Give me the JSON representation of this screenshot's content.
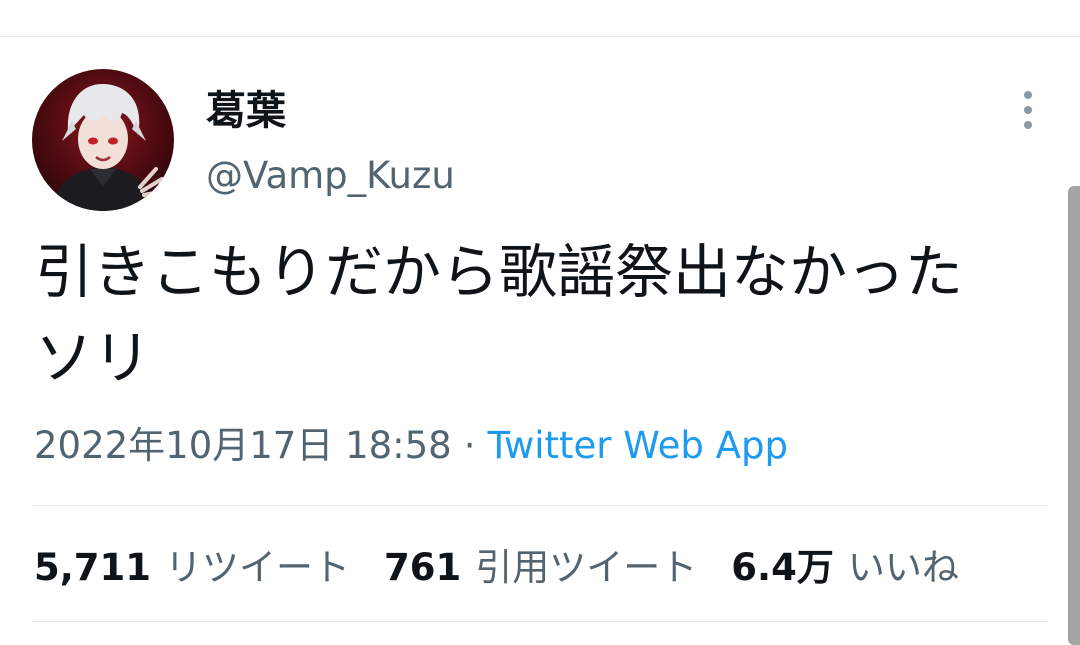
{
  "tweet": {
    "author": {
      "display_name": "葛葉",
      "handle": "@Vamp_Kuzu"
    },
    "text": "引きこもりだから歌謡祭出なかった\nソリ",
    "timestamp": "2022年10月17日 18:58",
    "separator": "·",
    "source": "Twitter Web App"
  },
  "stats": [
    {
      "count": "5,711",
      "label": "リツイート"
    },
    {
      "count": "761",
      "label": "引用ツイート"
    },
    {
      "count": "6.4万",
      "label": "いいね"
    }
  ],
  "icons": {
    "more": "more-vertical-icon"
  },
  "colors": {
    "text_primary": "#0f1419",
    "text_secondary": "#536471",
    "link": "#1d9bf0",
    "divider": "#e4e7ea"
  }
}
